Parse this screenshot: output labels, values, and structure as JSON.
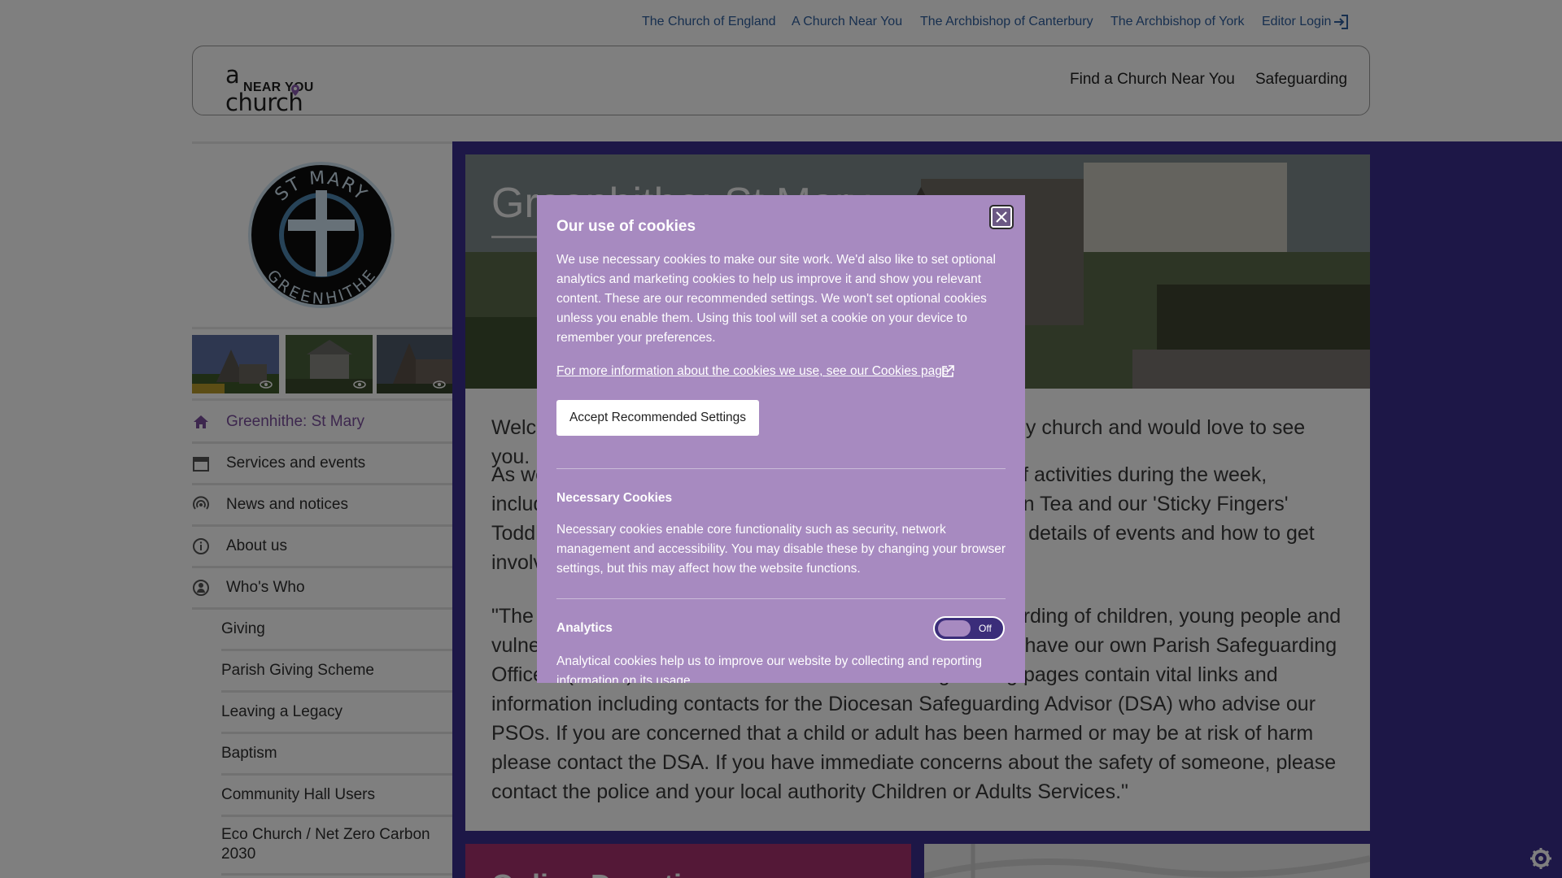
{
  "top_links": [
    "The Church of England",
    "A Church Near You",
    "The Archbishop of Canterbury",
    "The Archbishop of York",
    "Editor Login"
  ],
  "header": {
    "logo_line1": "a church",
    "logo_line2": "NEAR YOU",
    "nav": [
      "Find a Church Near You",
      "Safeguarding"
    ]
  },
  "badge": {
    "top_text": "ST MARY",
    "bottom_text": "GREENHITHE"
  },
  "sidebar": {
    "items": [
      {
        "label": "Greenhithe: St Mary",
        "icon": "home-icon"
      },
      {
        "label": "Services and events",
        "icon": "calendar-icon"
      },
      {
        "label": "News and notices",
        "icon": "broadcast-icon"
      },
      {
        "label": "About us",
        "icon": "info-icon"
      },
      {
        "label": "Who's Who",
        "icon": "person-icon"
      }
    ],
    "sub_items": [
      "Giving",
      "Parish Giving Scheme",
      "Leaving a Legacy",
      "Baptism",
      "Community Hall Users",
      "Eco Church / Net Zero Carbon 2030"
    ]
  },
  "hero": {
    "title": "Greenhithe: St Mary"
  },
  "main": {
    "paragraphs": [
      "Welcome to St Mary's Church, Greenhithe. We are a friendly church and would love to see you.",
      "As well as our regular Sunday services we have a variety of activities during the week, including our Wednesday coffee morning, Monthly Afternoon Tea and our 'Sticky Fingers' Toddler group. Please see our events page to access more details of events and how to get involved.",
      "\"The Parochial Church Council is committed to the safeguarding of children, young people and vulnerable adults. We follow the guidance and policies and have our own Parish Safeguarding Officers (PSOs). The Diocese of Rochester’s safeguarding pages contain vital links and information including contacts for the Diocesan Safeguarding Advisor (DSA) who advise our PSOs. If you are concerned that a child or adult has been harmed or may be at risk of harm please contact the DSA. If you have immediate concerns about the safety of someone, please contact the police and your local authority Children or Adults Services.\""
    ],
    "card_title": "Online Donations"
  },
  "cookie_dialog": {
    "title": "Our use of cookies",
    "intro": "We use necessary cookies to make our site work. We'd also like to set optional analytics and marketing cookies to help us improve it and show you relevant content. These are our recommended settings. We won't set optional cookies unless you enable them. Using this tool will set a cookie on your device to remember your preferences.",
    "more_link": "For more information about the cookies we use, see our Cookies page",
    "accept_label": "Accept Recommended Settings",
    "necessary_title": "Necessary Cookies",
    "necessary_desc": "Necessary cookies enable core functionality such as security, network management and accessibility. You may disable these by changing your browser settings, but this may affect how the website functions.",
    "analytics_title": "Analytics",
    "analytics_state": "Off",
    "analytics_desc": "Analytical cookies help us to improve our website by collecting and reporting information on its usage."
  },
  "colors": {
    "purple_bg": "#3a2f8f",
    "dialog_bg": "#a78ac0",
    "active_nav": "#7a4f9c",
    "link_blue": "#2f5f9e"
  }
}
